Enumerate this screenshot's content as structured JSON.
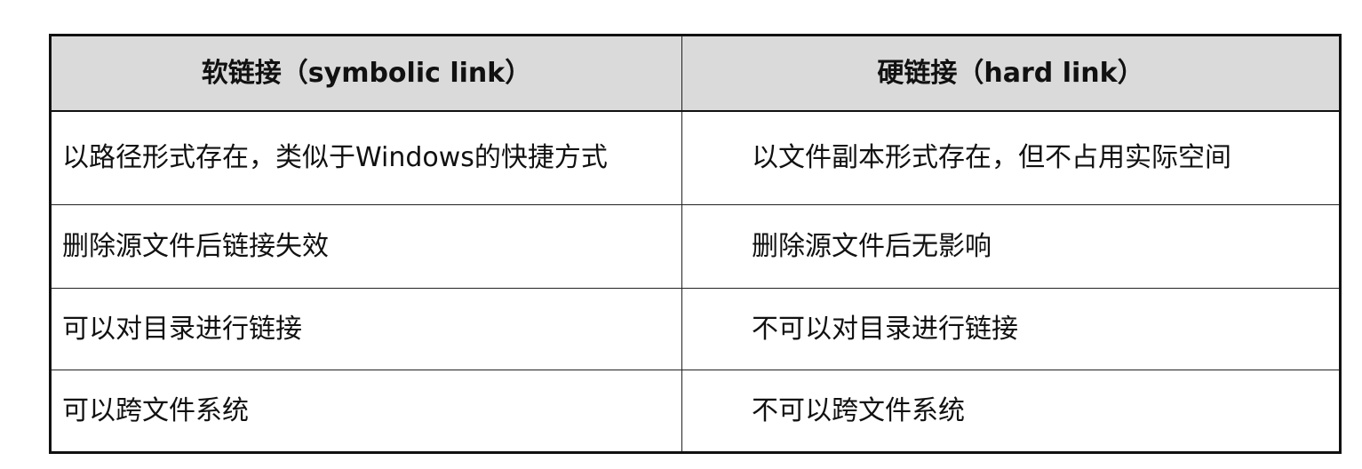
{
  "table": {
    "headers": [
      "软链接（symbolic link）",
      "硬链接（hard link）"
    ],
    "rows": [
      [
        "以路径形式存在，类似于Windows的快捷方式",
        "以文件副本形式存在，但不占用实际空间"
      ],
      [
        "删除源文件后链接失效",
        "删除源文件后无影响"
      ],
      [
        "可以对目录进行链接",
        "不可以对目录进行链接"
      ],
      [
        "可以跨文件系统",
        "不可以跨文件系统"
      ]
    ]
  }
}
